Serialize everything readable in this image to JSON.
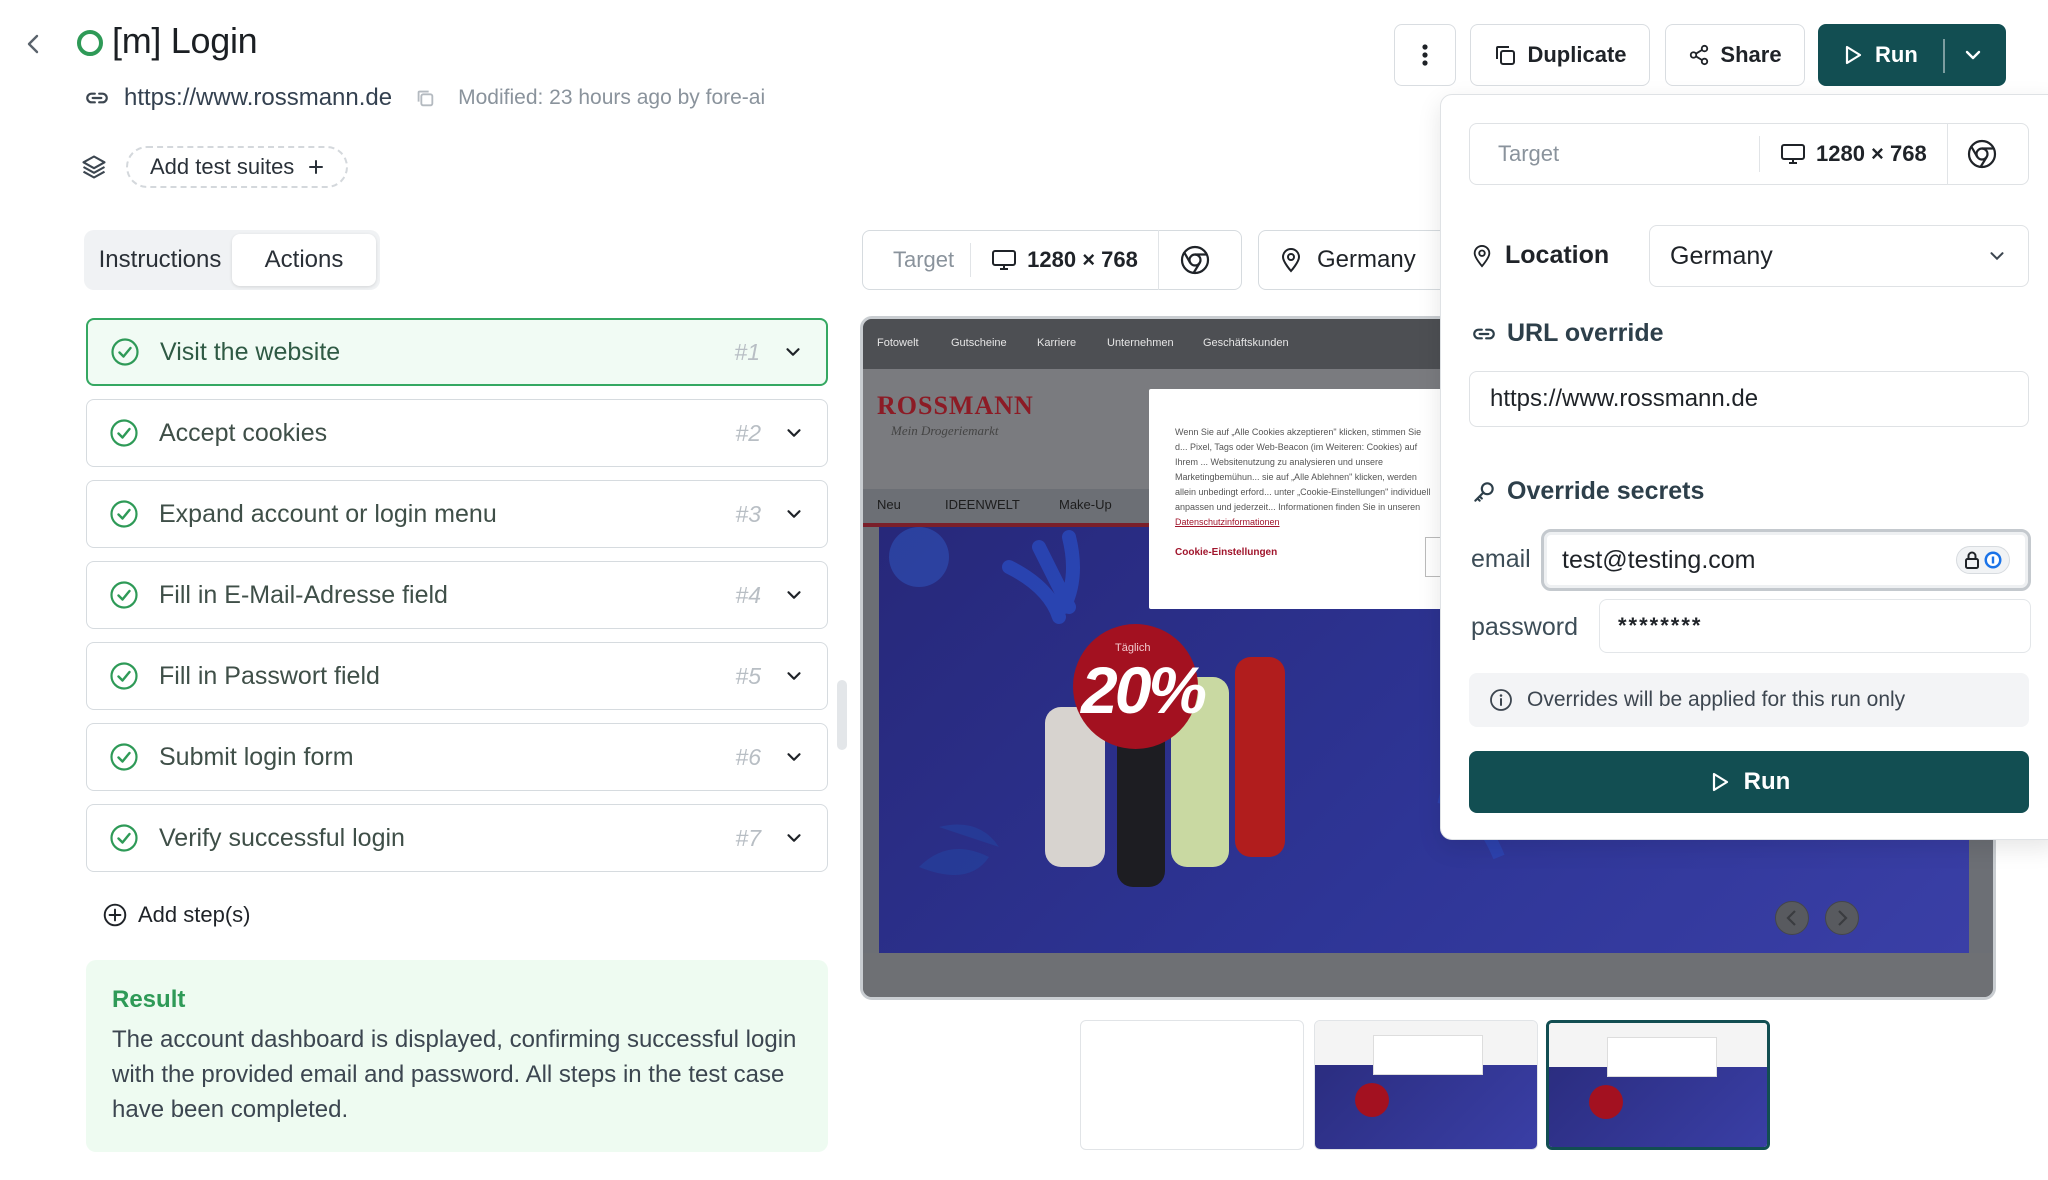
{
  "header": {
    "title": "[m] Login",
    "url": "https://www.rossmann.de",
    "modified": "Modified: 23 hours ago by fore-ai",
    "add_suites": "Add test suites"
  },
  "toolbar": {
    "duplicate": "Duplicate",
    "share": "Share",
    "run": "Run"
  },
  "tabs": [
    "Instructions",
    "Actions"
  ],
  "active_tab": "Actions",
  "steps": [
    {
      "label": "Visit the website",
      "num": "#1"
    },
    {
      "label": "Accept cookies",
      "num": "#2"
    },
    {
      "label": "Expand account or login menu",
      "num": "#3"
    },
    {
      "label": "Fill in E-Mail-Adresse field",
      "num": "#4"
    },
    {
      "label": "Fill in Passwort field",
      "num": "#5"
    },
    {
      "label": "Submit login form",
      "num": "#6"
    },
    {
      "label": "Verify successful login",
      "num": "#7"
    }
  ],
  "add_step": "Add step(s)",
  "result": {
    "title": "Result",
    "text": "The account dashboard is displayed, confirming successful login with the provided email and password. All steps in the test case have been completed."
  },
  "preview_toolbar": {
    "target_label": "Target",
    "resolution": "1280 × 768",
    "location": "Germany"
  },
  "preview": {
    "nav": [
      "Fotowelt",
      "Gutscheine",
      "Karriere",
      "Unternehmen",
      "Geschäftskunden"
    ],
    "logo": "ROSSMANN",
    "logo_sub": "Mein Drogeriemarkt",
    "menu": [
      "Neu",
      "IDEENWELT",
      "Make-Up"
    ],
    "cookie_text": "Wenn Sie auf „Alle Cookies akzeptieren\" klicken, stimmen Sie d... Pixel, Tags oder Web-Beacon (im Weiteren: Cookies) auf Ihrem ... Websitenutzung zu analysieren und unsere Marketingbemühun... sie auf „Alle Ablehnen\" klicken, werden allein unbedingt erford... unter „Cookie-Einstellungen\" individuell anpassen und jederzeit... Informationen finden Sie in unseren",
    "cookie_link": "Datenschutzinformationen",
    "cookie_settings": "Cookie-Einstellungen",
    "badge_small": "Täglich",
    "badge_pct": "20%"
  },
  "panel": {
    "target_label": "Target",
    "resolution": "1280 × 768",
    "location_label": "Location",
    "location_value": "Germany",
    "url_override_label": "URL override",
    "url_override_value": "https://www.rossmann.de",
    "override_secrets_label": "Override secrets",
    "email_label": "email",
    "email_value": "test@testing.com",
    "password_label": "password",
    "password_value": "********",
    "note": "Overrides will be applied for this run only",
    "run": "Run"
  },
  "colors": {
    "primary": "#124e52",
    "success": "#2e9a57",
    "result_bg": "#eefbf1"
  }
}
